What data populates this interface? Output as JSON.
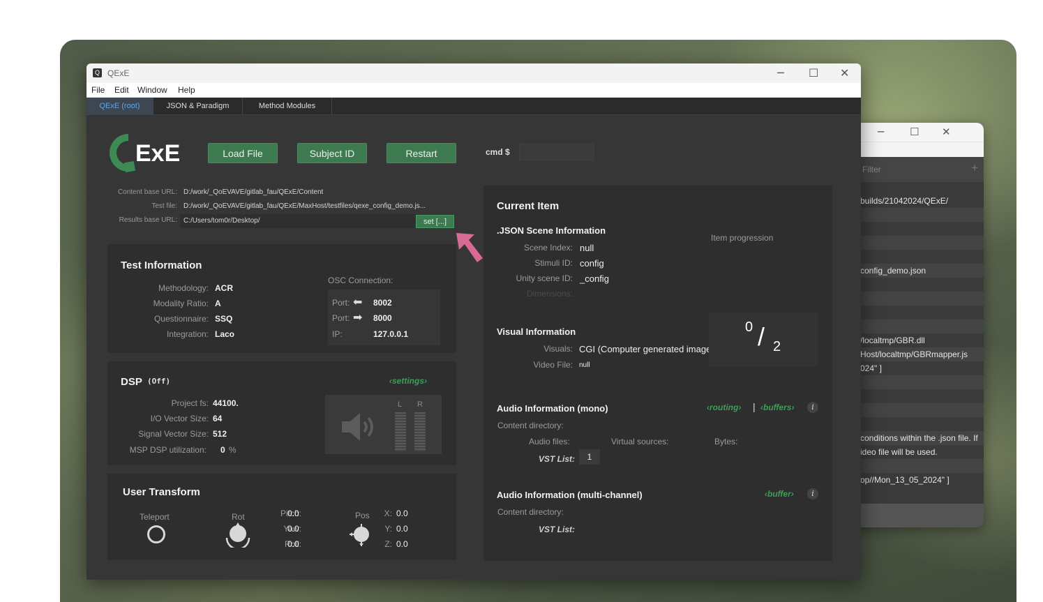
{
  "back_window": {
    "filter_placeholder": "Filter",
    "plus": "+",
    "rows": [
      "builds/21042024/QExE/",
      "",
      "",
      "",
      "",
      "config_demo.json",
      "",
      "",
      "",
      "",
      "/localtmp/GBR.dll",
      "Host/localtmp/GBRmapper.js",
      "024\" ]",
      "",
      "",
      "",
      "",
      "conditions within the .json file. If",
      "ideo file will be used.",
      "",
      "op//Mon_13_05_2024\" ]"
    ]
  },
  "window": {
    "title": "QExE",
    "menu": [
      "File",
      "Edit",
      "Window",
      "Help"
    ],
    "tabs": [
      "QExE (root)",
      "JSON & Paradigm",
      "Method Modules"
    ],
    "active_tab": 0
  },
  "toolbar": {
    "logo_text": "ExE",
    "load_file": "Load File",
    "subject_id": "Subject ID",
    "restart": "Restart",
    "cmd_label": "cmd $",
    "cmd_value": ""
  },
  "paths": {
    "content_label": "Content base URL:",
    "content_value": "D:/work/_QoEVAVE/gitlab_fau/QExE/Content",
    "test_label": "Test file:",
    "test_value": "D:/work/_QoEVAVE/gitlab_fau/QExE/MaxHost/testfiles/qexe_config_demo.js...",
    "results_label": "Results base URL:",
    "results_value": "C:/Users/tom0r/Desktop/",
    "set_button": "set [...]"
  },
  "test_info": {
    "title": "Test Information",
    "fields": [
      {
        "label": "Methodology:",
        "value": "ACR"
      },
      {
        "label": "Modality Ratio:",
        "value": "A"
      },
      {
        "label": "Questionnaire:",
        "value": "SSQ"
      },
      {
        "label": "Integration:",
        "value": "Laco"
      }
    ],
    "osc": {
      "title": "OSC Connection:",
      "port_in_label": "Port:",
      "port_in": "8002",
      "port_out_label": "Port:",
      "port_out": "8000",
      "ip_label": "IP:",
      "ip": "127.0.0.1"
    }
  },
  "dsp": {
    "title": "DSP",
    "state": "(Off)",
    "settings_link": "‹settings›",
    "fields": [
      {
        "label": "Project fs:",
        "value": "44100."
      },
      {
        "label": "I/O Vector Size:",
        "value": "64"
      },
      {
        "label": "Signal Vector Size:",
        "value": "512"
      },
      {
        "label": "MSP DSP utilization:",
        "value": "0"
      }
    ],
    "percent": "%",
    "meter_l": "L",
    "meter_r": "R"
  },
  "user_transform": {
    "title": "User Transform",
    "teleport": "Teleport",
    "rot": "Rot",
    "pos": "Pos",
    "rotation": [
      {
        "label": "Pitch:",
        "value": "0.0"
      },
      {
        "label": "Yaw:",
        "value": "0.0"
      },
      {
        "label": "Roll:",
        "value": "0.0"
      }
    ],
    "position": [
      {
        "label": "X:",
        "value": "0.0"
      },
      {
        "label": "Y:",
        "value": "0.0"
      },
      {
        "label": "Z:",
        "value": "0.0"
      }
    ]
  },
  "current_item": {
    "title": "Current Item",
    "scene_title": ".JSON Scene Information",
    "scene": [
      {
        "label": "Scene Index:",
        "value": "null"
      },
      {
        "label": "Stimuli ID:",
        "value": "config"
      },
      {
        "label": "Unity scene ID:",
        "value": "_config"
      },
      {
        "label": "Dimensions:",
        "value": ""
      }
    ],
    "progression_label": "Item progression",
    "progress_current": "0",
    "progress_total": "2",
    "visual_title": "Visual Information",
    "visuals_label": "Visuals:",
    "visuals_value": "CGI (Computer generated imagery)",
    "video_label": "Video File:",
    "video_value": "null",
    "audio_mono_title": "Audio Information (mono)",
    "routing_link": "‹routing›",
    "buffers_link": "‹buffers›",
    "separator": "|",
    "content_dir_label": "Content directory:",
    "audio_files_label": "Audio files:",
    "virtual_sources_label": "Virtual sources:",
    "bytes_label": "Bytes:",
    "vst_list_label": "VST List:",
    "vst_list_value": "1",
    "audio_multi_title": "Audio Information (multi-channel)",
    "buffer_link": "‹buffer›",
    "content_dir_label_2": "Content directory:",
    "vst_list_label_2": "VST List:",
    "info_glyph": "i"
  },
  "colors": {
    "accent_green": "#3d7a50",
    "link_green": "#3e9e58",
    "active_tab_text": "#5aa8ef",
    "annotation_arrow": "#d96a93"
  }
}
